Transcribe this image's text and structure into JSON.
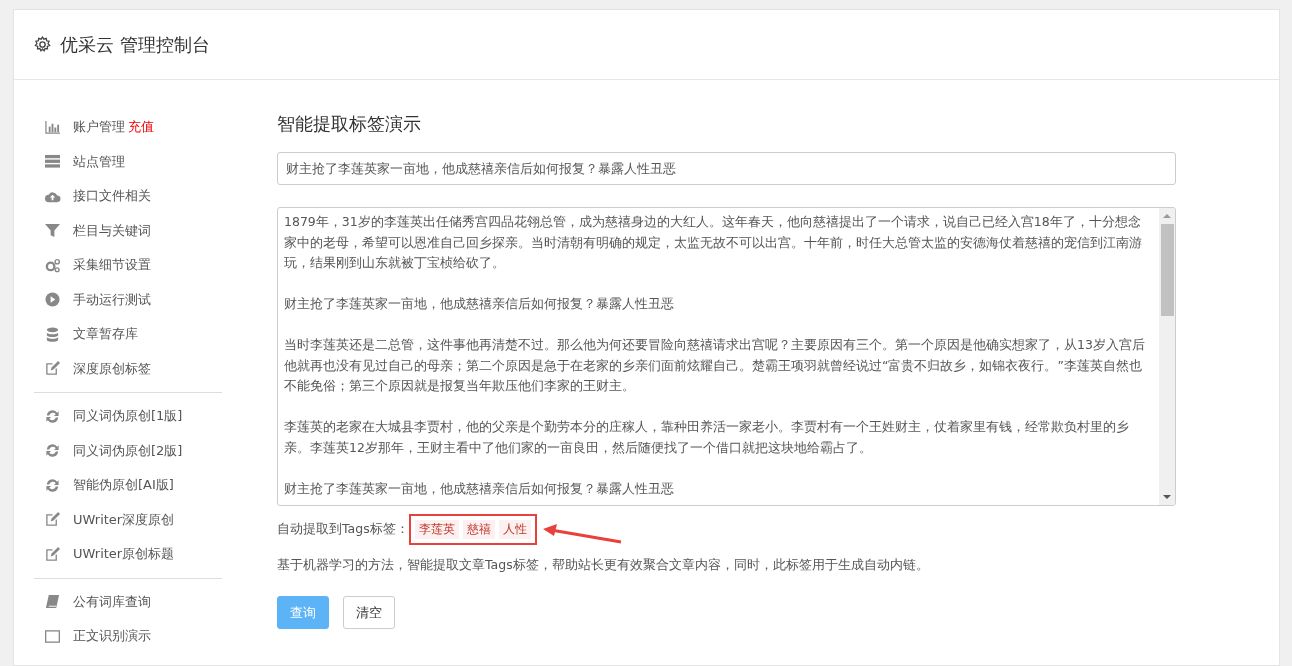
{
  "header": {
    "title": "优采云 管理控制台"
  },
  "sidebar": {
    "groups": [
      {
        "items": [
          {
            "label": "账户管理",
            "badge": "充值"
          },
          {
            "label": "站点管理"
          },
          {
            "label": "接口文件相关"
          },
          {
            "label": "栏目与关键词"
          },
          {
            "label": "采集细节设置"
          },
          {
            "label": "手动运行测试"
          },
          {
            "label": "文章暂存库"
          },
          {
            "label": "深度原创标签"
          }
        ]
      },
      {
        "items": [
          {
            "label": "同义词伪原创[1版]"
          },
          {
            "label": "同义词伪原创[2版]"
          },
          {
            "label": "智能伪原创[AI版]"
          },
          {
            "label": "UWriter深度原创"
          },
          {
            "label": "UWriter原创标题"
          }
        ]
      },
      {
        "items": [
          {
            "label": "公有词库查询"
          },
          {
            "label": "正文识别演示"
          }
        ]
      }
    ]
  },
  "main": {
    "heading": "智能提取标签演示",
    "title_field": {
      "value": "财主抢了李莲英家一亩地，他成慈禧亲信后如何报复？暴露人性丑恶"
    },
    "content_field": {
      "paragraphs": [
        "1879年，31岁的李莲英出任储秀宫四品花翎总管，成为慈禧身边的大红人。这年春天，他向慈禧提出了一个请求，说自己已经入宫18年了，十分想念家中的老母，希望可以恩准自己回乡探亲。当时清朝有明确的规定，太监无故不可以出宫。十年前，时任大总管太监的安德海仗着慈禧的宠信到江南游玩，结果刚到山东就被丁宝桢给砍了。",
        "财主抢了李莲英家一亩地，他成慈禧亲信后如何报复？暴露人性丑恶",
        "当时李莲英还是二总管，这件事他再清楚不过。那么他为何还要冒险向慈禧请求出宫呢？主要原因有三个。第一个原因是他确实想家了，从13岁入宫后他就再也没有见过自己的母亲；第二个原因是急于在老家的乡亲们面前炫耀自己。楚霸王项羽就曾经说过“富贵不归故乡，如锦衣夜行。”李莲英自然也不能免俗；第三个原因就是报复当年欺压他们李家的王财主。",
        "李莲英的老家在大城县李贾村，他的父亲是个勤劳本分的庄稼人，靠种田养活一家老小。李贾村有一个王姓财主，仗着家里有钱，经常欺负村里的乡亲。李莲英12岁那年，王财主看中了他们家的一亩良田，然后随便找了一个借口就把这块地给霸占了。",
        "财主抢了李莲英家一亩地，他成慈禧亲信后如何报复？暴露人性丑恶"
      ]
    },
    "tags_label": "自动提取到Tags标签：",
    "tags": [
      "李莲英",
      "慈禧",
      "人性"
    ],
    "description": "基于机器学习的方法，智能提取文章Tags标签，帮助站长更有效聚合文章内容，同时，此标签用于生成自动内链。",
    "buttons": [
      {
        "label": "查询",
        "kind": "primary"
      },
      {
        "label": "清空",
        "kind": "default"
      }
    ]
  }
}
